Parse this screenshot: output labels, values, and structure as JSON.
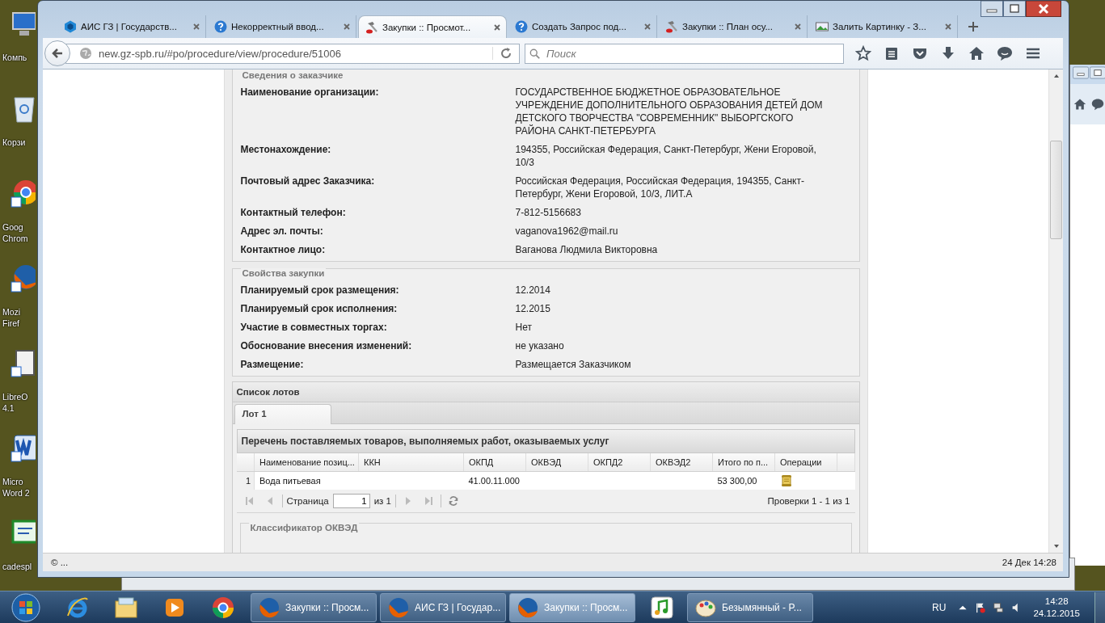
{
  "desktop": {
    "icons": [
      {
        "kind": "computer",
        "lines": [
          "Компь"
        ]
      },
      {
        "kind": "recycle",
        "lines": [
          "Корзи"
        ]
      },
      {
        "kind": "chrome",
        "lines": [
          "Goog",
          "Chrom"
        ]
      },
      {
        "kind": "firefox",
        "lines": [
          "Mozi",
          "Firef"
        ]
      },
      {
        "kind": "document",
        "lines": [
          "LibreO",
          "4.1"
        ]
      },
      {
        "kind": "word",
        "lines": [
          "Micro",
          "Word 2"
        ]
      },
      {
        "kind": "certificate",
        "lines": [
          "cadespl"
        ]
      }
    ]
  },
  "browser": {
    "tabs": [
      {
        "title": "АИС ГЗ | Государств...",
        "kind": "hex",
        "selected": false
      },
      {
        "title": "Некорректный ввод...",
        "kind": "help",
        "selected": false
      },
      {
        "title": "Закупки :: Просмот...",
        "kind": "hammer",
        "selected": true
      },
      {
        "title": "Создать Запрос под...",
        "kind": "help",
        "selected": false
      },
      {
        "title": "Закупки :: План осу...",
        "kind": "hammer",
        "selected": false
      },
      {
        "title": "Залить Картинку - З...",
        "kind": "image",
        "selected": false
      }
    ],
    "url": "new.gz-spb.ru/#po/procedure/view/procedure/51006",
    "search": {
      "placeholder": "Поиск"
    },
    "status": {
      "left": "© ...",
      "right": "24 Дек 14:28"
    }
  },
  "customer": {
    "legend": "Сведения о заказчике",
    "rows": [
      {
        "label": "Наименование организации:",
        "value": "ГОСУДАРСТВЕННОЕ БЮДЖЕТНОЕ ОБРАЗОВАТЕЛЬНОЕ УЧРЕЖДЕНИЕ ДОПОЛНИТЕЛЬНОГО ОБРАЗОВАНИЯ ДЕТЕЙ ДОМ ДЕТСКОГО ТВОРЧЕСТВА \"СОВРЕМЕННИК\" ВЫБОРГСКОГО РАЙОНА САНКТ-ПЕТЕРБУРГА"
      },
      {
        "label": "Местонахождение:",
        "value": "194355, Российская Федерация, Санкт-Петербург, Жени Егоровой, 10/3"
      },
      {
        "label": "Почтовый адрес Заказчика:",
        "value": "Российская Федерация, Российская Федерация, 194355, Санкт-Петербург, Жени Егоровой, 10/3, ЛИТ.А"
      },
      {
        "label": "Контактный телефон:",
        "value": "7-812-5156683"
      },
      {
        "label": "Адрес эл. почты:",
        "value": "vaganova1962@mail.ru"
      },
      {
        "label": "Контактное лицо:",
        "value": "Ваганова Людмила Викторовна"
      }
    ]
  },
  "properties": {
    "legend": "Свойства закупки",
    "rows": [
      {
        "label": "Планируемый срок размещения:",
        "value": "12.2014"
      },
      {
        "label": "Планируемый срок исполнения:",
        "value": "12.2015"
      },
      {
        "label": "Участие в совместных торгах:",
        "value": "Нет"
      },
      {
        "label": "Обоснование внесения изменений:",
        "value": "не указано"
      },
      {
        "label": "Размещение:",
        "value": "Размещается Заказчиком"
      }
    ]
  },
  "lots": {
    "title": "Список лотов",
    "tabs": [
      {
        "label": "Лот 1",
        "selected": true
      }
    ],
    "panel_title": "Перечень поставляемых товаров, выполняемых работ, оказываемых услуг",
    "columns": [
      "Наименование позиц...",
      "ККН",
      "ОКПД",
      "ОКВЭД",
      "ОКПД2",
      "ОКВЭД2",
      "Итого по п...",
      "Операции"
    ],
    "rows": [
      {
        "number": "1",
        "name": "Вода питьевая",
        "okpd": "41.00.11.000",
        "total": "53 300,00",
        "operations": true
      }
    ],
    "pager": {
      "page_label": "Страница",
      "page": "1",
      "of": "из 1",
      "summary": "Проверки 1 - 1 из 1"
    },
    "next_section": "Классификатор ОКВЭД"
  },
  "taskbar": {
    "pinned": [
      {
        "kind": "ie"
      },
      {
        "kind": "explorer"
      },
      {
        "kind": "media"
      },
      {
        "kind": "chrome"
      }
    ],
    "tasks": [
      {
        "kind": "firefox",
        "label": "Закупки :: Просм...",
        "selected": false
      },
      {
        "kind": "firefox",
        "label": "АИС ГЗ | Государ...",
        "selected": false
      },
      {
        "kind": "firefox",
        "label": "Закупки :: Просм...",
        "selected": true
      },
      {
        "kind": "music",
        "selected": false
      },
      {
        "kind": "paint",
        "label": "Безымянный - P...",
        "selected": false
      }
    ],
    "language": "RU",
    "time": "14:28",
    "date": "24.12.2015"
  }
}
